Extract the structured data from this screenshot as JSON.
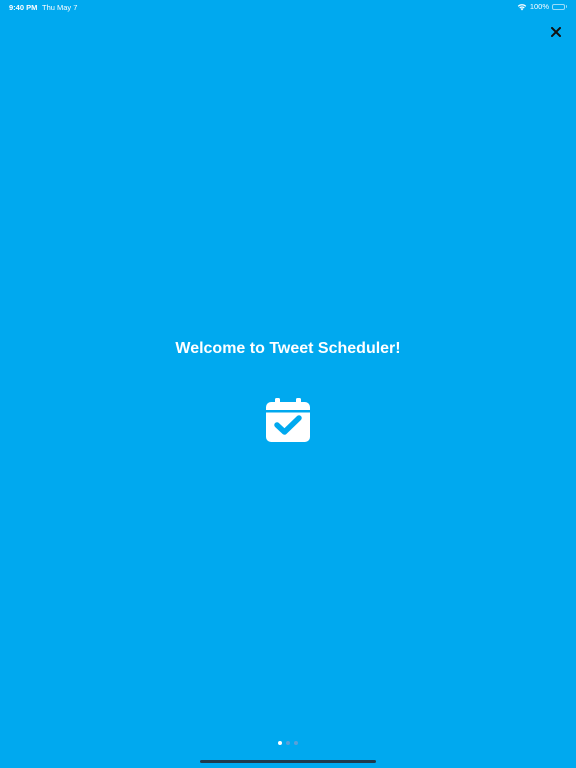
{
  "colors": {
    "background": "#00a9ef",
    "foreground": "#ffffff",
    "close_icon": "#111111",
    "dot_active": "#ffffff",
    "dot_inactive": "#5aa0d8",
    "home_indicator": "#1f3a4d"
  },
  "status_bar": {
    "time": "9:40 PM",
    "date": "Thu May 7",
    "battery": "100%",
    "icons": [
      "wifi-icon",
      "battery-icon"
    ]
  },
  "close_button": {
    "icon": "close-icon"
  },
  "welcome": {
    "title": "Welcome to Tweet Scheduler!",
    "icon": "calendar-check-icon"
  },
  "pager": {
    "total": 3,
    "current_index": 0
  }
}
